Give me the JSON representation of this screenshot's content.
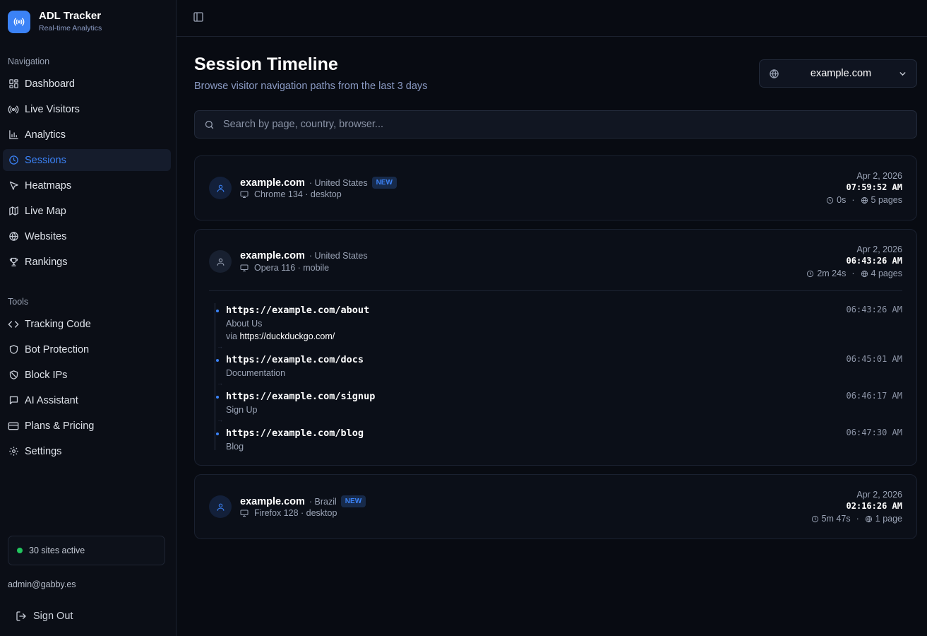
{
  "brand": {
    "name": "ADL Tracker",
    "subtitle": "Real-time Analytics"
  },
  "sidebar": {
    "nav_label": "Navigation",
    "nav": [
      {
        "label": "Dashboard",
        "icon": "grid-icon"
      },
      {
        "label": "Live Visitors",
        "icon": "radio-icon"
      },
      {
        "label": "Analytics",
        "icon": "bar-chart-icon"
      },
      {
        "label": "Sessions",
        "icon": "clock-icon",
        "active": true
      },
      {
        "label": "Heatmaps",
        "icon": "pointer-icon"
      },
      {
        "label": "Live Map",
        "icon": "map-icon"
      },
      {
        "label": "Websites",
        "icon": "globe-icon"
      },
      {
        "label": "Rankings",
        "icon": "trophy-icon"
      }
    ],
    "tools_label": "Tools",
    "tools": [
      {
        "label": "Tracking Code",
        "icon": "code-icon"
      },
      {
        "label": "Bot Protection",
        "icon": "shield-icon"
      },
      {
        "label": "Block IPs",
        "icon": "shield-off-icon"
      },
      {
        "label": "AI Assistant",
        "icon": "chat-icon"
      },
      {
        "label": "Plans & Pricing",
        "icon": "credit-card-icon"
      },
      {
        "label": "Settings",
        "icon": "gear-icon"
      }
    ],
    "sites_active": "30 sites active",
    "user_email": "admin@gabby.es",
    "sign_out": "Sign Out"
  },
  "header": {
    "title": "Session Timeline",
    "subtitle": "Browse visitor navigation paths from the last 3 days",
    "site_select": "example.com"
  },
  "search": {
    "placeholder": "Search by page, country, browser..."
  },
  "sessions": [
    {
      "site": "example.com",
      "country": "· United States",
      "badge": "NEW",
      "device": "Chrome 134 · desktop",
      "date": "Apr 2, 2026",
      "time": "07:59:52 AM",
      "duration": "0s",
      "pages": "5 pages"
    },
    {
      "site": "example.com",
      "country": "· United States",
      "device": "Opera 116 · mobile",
      "date": "Apr 2, 2026",
      "time": "06:43:26 AM",
      "duration": "2m 24s",
      "pages": "4 pages",
      "path": [
        {
          "url": "https://example.com/about",
          "title": "About Us",
          "via_prefix": "via",
          "via": "https://duckduckgo.com/",
          "time": "06:43:26 AM"
        },
        {
          "url": "https://example.com/docs",
          "title": "Documentation",
          "time": "06:45:01 AM"
        },
        {
          "url": "https://example.com/signup",
          "title": "Sign Up",
          "time": "06:46:17 AM"
        },
        {
          "url": "https://example.com/blog",
          "title": "Blog",
          "time": "06:47:30 AM"
        }
      ]
    },
    {
      "site": "example.com",
      "country": "· Brazil",
      "badge": "NEW",
      "device": "Firefox 128 · desktop",
      "date": "Apr 2, 2026",
      "time": "02:16:26 AM",
      "duration": "5m 47s",
      "pages": "1 page"
    }
  ],
  "colors": {
    "accent": "#3b82f6",
    "background": "#080b12",
    "online": "#22c55e"
  }
}
